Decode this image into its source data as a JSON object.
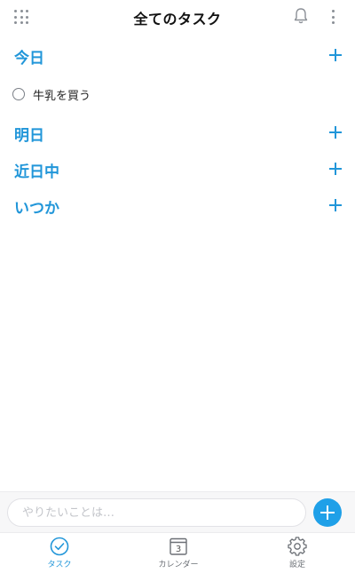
{
  "header": {
    "title": "全てのタスク",
    "left_icon": "grid-menu-icon",
    "right_icons": [
      "bell-icon",
      "more-vertical-icon"
    ]
  },
  "sections": [
    {
      "title": "今日",
      "tasks": [
        {
          "label": "牛乳を買う",
          "done": false
        }
      ]
    },
    {
      "title": "明日",
      "tasks": []
    },
    {
      "title": "近日中",
      "tasks": []
    },
    {
      "title": "いつか",
      "tasks": []
    }
  ],
  "input": {
    "placeholder": "やりたいことは…",
    "value": ""
  },
  "bottom_nav": {
    "items": [
      {
        "label": "タスク",
        "icon": "check-circle-icon",
        "active": true
      },
      {
        "label": "カレンダー",
        "icon": "calendar-icon",
        "active": false,
        "icon_text": "3"
      },
      {
        "label": "設定",
        "icon": "gear-icon",
        "active": false
      }
    ]
  },
  "colors": {
    "accent": "#2196d9",
    "fab": "#1fa0e8",
    "muted": "#6b6f75"
  }
}
